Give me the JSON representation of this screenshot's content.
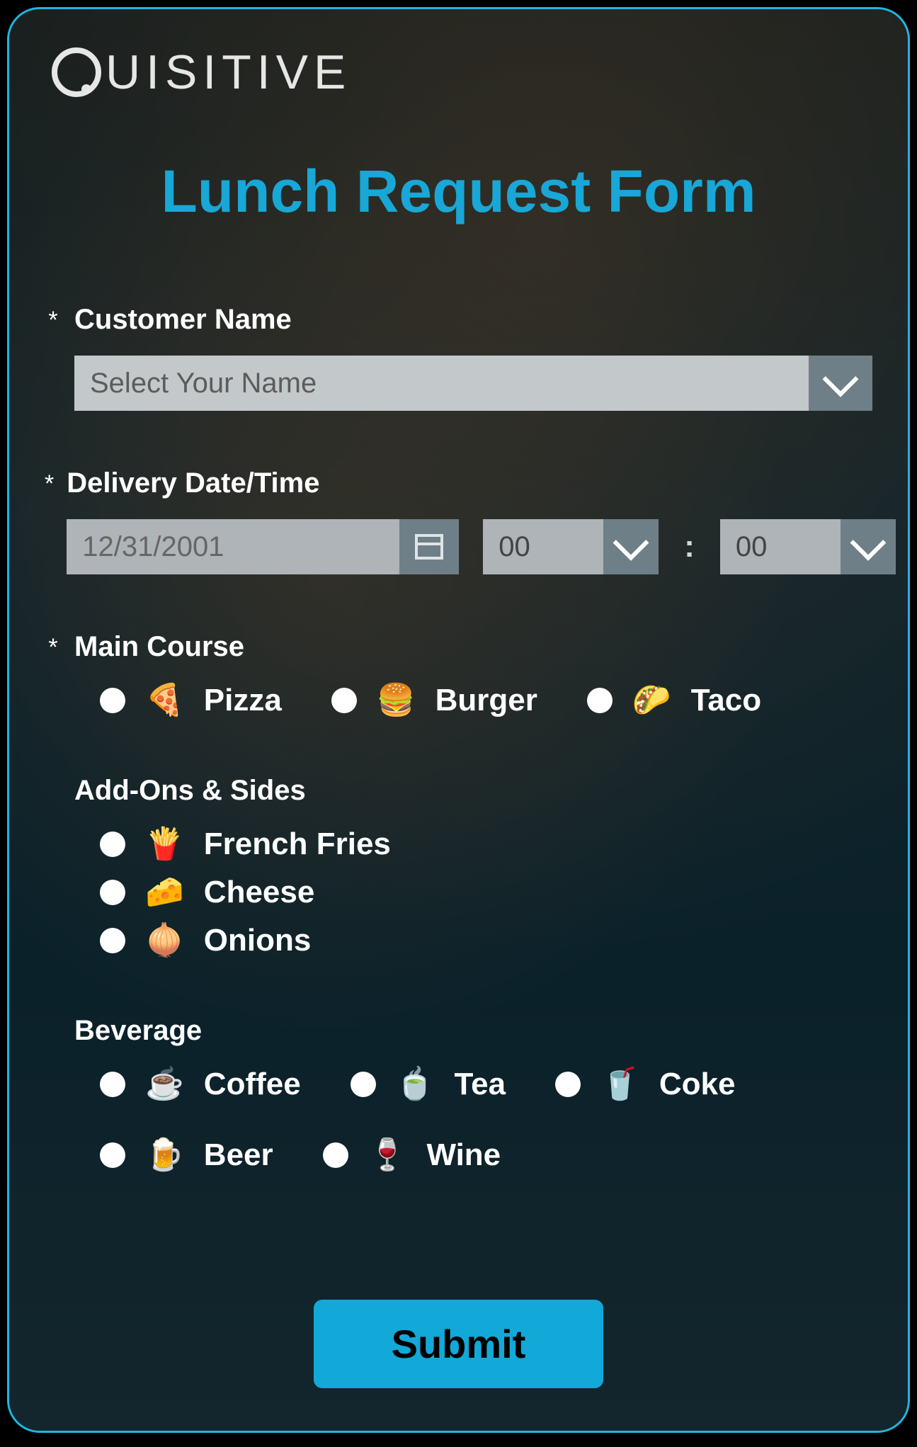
{
  "brand": "UISITIVE",
  "title": "Lunch Request Form",
  "required_marker": "*",
  "fields": {
    "customer_name": {
      "label": "Customer Name",
      "placeholder": "Select Your Name",
      "required": true
    },
    "delivery": {
      "label": "Delivery Date/Time",
      "date": "12/31/2001",
      "hour": "00",
      "minute": "00",
      "required": true
    },
    "main_course": {
      "label": "Main Course",
      "required": true,
      "options": [
        {
          "emoji": "🍕",
          "label": "Pizza"
        },
        {
          "emoji": "🍔",
          "label": "Burger"
        },
        {
          "emoji": "🌮",
          "label": "Taco"
        }
      ]
    },
    "addons": {
      "label": "Add-Ons & Sides",
      "required": false,
      "options": [
        {
          "emoji": "🍟",
          "label": "French Fries"
        },
        {
          "emoji": "🧀",
          "label": "Cheese"
        },
        {
          "emoji": "🧅",
          "label": "Onions"
        }
      ]
    },
    "beverage": {
      "label": "Beverage",
      "required": false,
      "options": [
        {
          "emoji": "☕",
          "label": "Coffee"
        },
        {
          "emoji": "🍵",
          "label": "Tea"
        },
        {
          "emoji": "🥤",
          "label": "Coke"
        },
        {
          "emoji": "🍺",
          "label": "Beer"
        },
        {
          "emoji": "🍷",
          "label": "Wine"
        }
      ]
    }
  },
  "submit_label": "Submit"
}
